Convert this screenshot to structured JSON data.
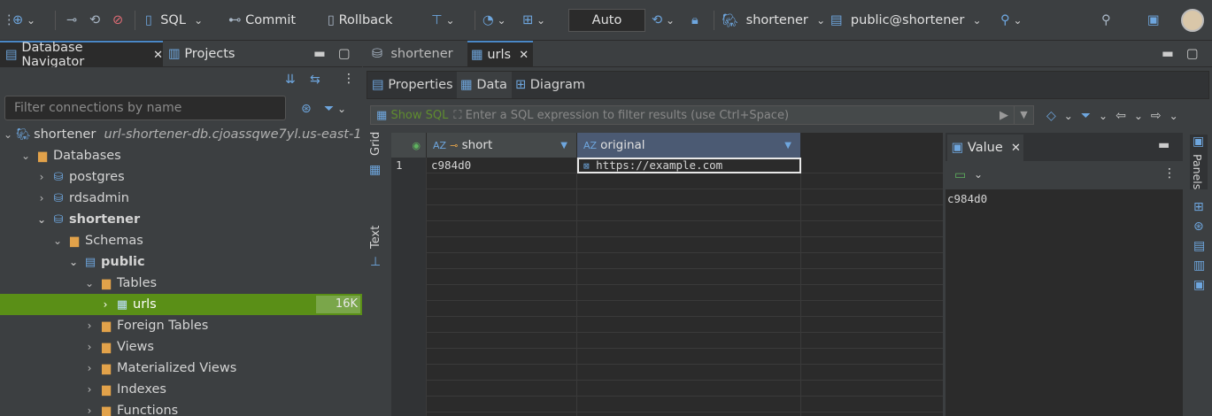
{
  "toolbar": {
    "sql_label": "SQL",
    "commit_label": "Commit",
    "rollback_label": "Rollback",
    "transaction_mode": "Auto",
    "active_datasource": "shortener",
    "active_schema": "public@shortener"
  },
  "left_panel": {
    "tabs": [
      {
        "label": "Database Navigator"
      },
      {
        "label": "Projects"
      }
    ],
    "filter_placeholder": "Filter connections by name",
    "tree": [
      {
        "label": "shortener",
        "detail": "url-shortener-db.cjoassqwe7yl.us-east-1.rd..."
      },
      {
        "label": "Databases"
      },
      {
        "label": "postgres"
      },
      {
        "label": "rdsadmin"
      },
      {
        "label": "shortener"
      },
      {
        "label": "Schemas"
      },
      {
        "label": "public"
      },
      {
        "label": "Tables"
      },
      {
        "label": "urls",
        "count": "16K"
      },
      {
        "label": "Foreign Tables"
      },
      {
        "label": "Views"
      },
      {
        "label": "Materialized Views"
      },
      {
        "label": "Indexes"
      },
      {
        "label": "Functions"
      }
    ]
  },
  "editor": {
    "tabs": [
      {
        "label": "shortener"
      },
      {
        "label": "urls"
      }
    ],
    "subtabs": [
      {
        "label": "Properties"
      },
      {
        "label": "Data"
      },
      {
        "label": "Diagram"
      }
    ],
    "show_sql_label": "Show SQL",
    "filter_placeholder": "Enter a SQL expression to filter results (use Ctrl+Space)",
    "side_labels": {
      "grid": "Grid",
      "text": "Text"
    },
    "columns": [
      {
        "name": "short",
        "type_icon": "AZ"
      },
      {
        "name": "original",
        "type_icon": "AZ"
      }
    ],
    "rows": [
      {
        "num": "1",
        "short": "c984d0",
        "original": "https://example.com"
      }
    ],
    "value_panel": {
      "title": "Value",
      "content": "c984d0"
    },
    "panels_label": "Panels"
  },
  "colors": {
    "selection": "#5a8f17",
    "accent": "#4a88c7"
  }
}
